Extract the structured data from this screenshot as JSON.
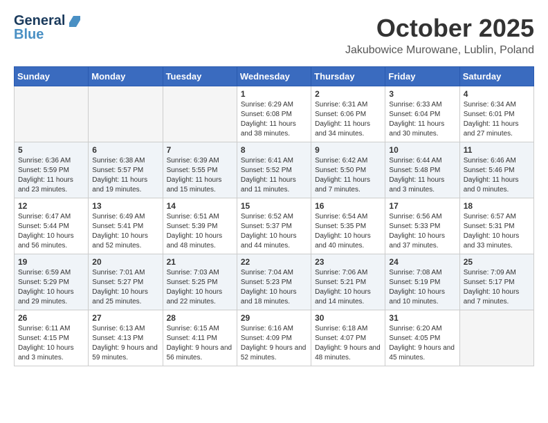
{
  "header": {
    "logo_line1": "General",
    "logo_line2": "Blue",
    "title": "October 2025",
    "subtitle": "Jakubowice Murowane, Lublin, Poland"
  },
  "weekdays": [
    "Sunday",
    "Monday",
    "Tuesday",
    "Wednesday",
    "Thursday",
    "Friday",
    "Saturday"
  ],
  "weeks": [
    [
      {
        "day": "",
        "sunrise": "",
        "sunset": "",
        "daylight": ""
      },
      {
        "day": "",
        "sunrise": "",
        "sunset": "",
        "daylight": ""
      },
      {
        "day": "",
        "sunrise": "",
        "sunset": "",
        "daylight": ""
      },
      {
        "day": "1",
        "sunrise": "Sunrise: 6:29 AM",
        "sunset": "Sunset: 6:08 PM",
        "daylight": "Daylight: 11 hours and 38 minutes."
      },
      {
        "day": "2",
        "sunrise": "Sunrise: 6:31 AM",
        "sunset": "Sunset: 6:06 PM",
        "daylight": "Daylight: 11 hours and 34 minutes."
      },
      {
        "day": "3",
        "sunrise": "Sunrise: 6:33 AM",
        "sunset": "Sunset: 6:04 PM",
        "daylight": "Daylight: 11 hours and 30 minutes."
      },
      {
        "day": "4",
        "sunrise": "Sunrise: 6:34 AM",
        "sunset": "Sunset: 6:01 PM",
        "daylight": "Daylight: 11 hours and 27 minutes."
      }
    ],
    [
      {
        "day": "5",
        "sunrise": "Sunrise: 6:36 AM",
        "sunset": "Sunset: 5:59 PM",
        "daylight": "Daylight: 11 hours and 23 minutes."
      },
      {
        "day": "6",
        "sunrise": "Sunrise: 6:38 AM",
        "sunset": "Sunset: 5:57 PM",
        "daylight": "Daylight: 11 hours and 19 minutes."
      },
      {
        "day": "7",
        "sunrise": "Sunrise: 6:39 AM",
        "sunset": "Sunset: 5:55 PM",
        "daylight": "Daylight: 11 hours and 15 minutes."
      },
      {
        "day": "8",
        "sunrise": "Sunrise: 6:41 AM",
        "sunset": "Sunset: 5:52 PM",
        "daylight": "Daylight: 11 hours and 11 minutes."
      },
      {
        "day": "9",
        "sunrise": "Sunrise: 6:42 AM",
        "sunset": "Sunset: 5:50 PM",
        "daylight": "Daylight: 11 hours and 7 minutes."
      },
      {
        "day": "10",
        "sunrise": "Sunrise: 6:44 AM",
        "sunset": "Sunset: 5:48 PM",
        "daylight": "Daylight: 11 hours and 3 minutes."
      },
      {
        "day": "11",
        "sunrise": "Sunrise: 6:46 AM",
        "sunset": "Sunset: 5:46 PM",
        "daylight": "Daylight: 11 hours and 0 minutes."
      }
    ],
    [
      {
        "day": "12",
        "sunrise": "Sunrise: 6:47 AM",
        "sunset": "Sunset: 5:44 PM",
        "daylight": "Daylight: 10 hours and 56 minutes."
      },
      {
        "day": "13",
        "sunrise": "Sunrise: 6:49 AM",
        "sunset": "Sunset: 5:41 PM",
        "daylight": "Daylight: 10 hours and 52 minutes."
      },
      {
        "day": "14",
        "sunrise": "Sunrise: 6:51 AM",
        "sunset": "Sunset: 5:39 PM",
        "daylight": "Daylight: 10 hours and 48 minutes."
      },
      {
        "day": "15",
        "sunrise": "Sunrise: 6:52 AM",
        "sunset": "Sunset: 5:37 PM",
        "daylight": "Daylight: 10 hours and 44 minutes."
      },
      {
        "day": "16",
        "sunrise": "Sunrise: 6:54 AM",
        "sunset": "Sunset: 5:35 PM",
        "daylight": "Daylight: 10 hours and 40 minutes."
      },
      {
        "day": "17",
        "sunrise": "Sunrise: 6:56 AM",
        "sunset": "Sunset: 5:33 PM",
        "daylight": "Daylight: 10 hours and 37 minutes."
      },
      {
        "day": "18",
        "sunrise": "Sunrise: 6:57 AM",
        "sunset": "Sunset: 5:31 PM",
        "daylight": "Daylight: 10 hours and 33 minutes."
      }
    ],
    [
      {
        "day": "19",
        "sunrise": "Sunrise: 6:59 AM",
        "sunset": "Sunset: 5:29 PM",
        "daylight": "Daylight: 10 hours and 29 minutes."
      },
      {
        "day": "20",
        "sunrise": "Sunrise: 7:01 AM",
        "sunset": "Sunset: 5:27 PM",
        "daylight": "Daylight: 10 hours and 25 minutes."
      },
      {
        "day": "21",
        "sunrise": "Sunrise: 7:03 AM",
        "sunset": "Sunset: 5:25 PM",
        "daylight": "Daylight: 10 hours and 22 minutes."
      },
      {
        "day": "22",
        "sunrise": "Sunrise: 7:04 AM",
        "sunset": "Sunset: 5:23 PM",
        "daylight": "Daylight: 10 hours and 18 minutes."
      },
      {
        "day": "23",
        "sunrise": "Sunrise: 7:06 AM",
        "sunset": "Sunset: 5:21 PM",
        "daylight": "Daylight: 10 hours and 14 minutes."
      },
      {
        "day": "24",
        "sunrise": "Sunrise: 7:08 AM",
        "sunset": "Sunset: 5:19 PM",
        "daylight": "Daylight: 10 hours and 10 minutes."
      },
      {
        "day": "25",
        "sunrise": "Sunrise: 7:09 AM",
        "sunset": "Sunset: 5:17 PM",
        "daylight": "Daylight: 10 hours and 7 minutes."
      }
    ],
    [
      {
        "day": "26",
        "sunrise": "Sunrise: 6:11 AM",
        "sunset": "Sunset: 4:15 PM",
        "daylight": "Daylight: 10 hours and 3 minutes."
      },
      {
        "day": "27",
        "sunrise": "Sunrise: 6:13 AM",
        "sunset": "Sunset: 4:13 PM",
        "daylight": "Daylight: 9 hours and 59 minutes."
      },
      {
        "day": "28",
        "sunrise": "Sunrise: 6:15 AM",
        "sunset": "Sunset: 4:11 PM",
        "daylight": "Daylight: 9 hours and 56 minutes."
      },
      {
        "day": "29",
        "sunrise": "Sunrise: 6:16 AM",
        "sunset": "Sunset: 4:09 PM",
        "daylight": "Daylight: 9 hours and 52 minutes."
      },
      {
        "day": "30",
        "sunrise": "Sunrise: 6:18 AM",
        "sunset": "Sunset: 4:07 PM",
        "daylight": "Daylight: 9 hours and 48 minutes."
      },
      {
        "day": "31",
        "sunrise": "Sunrise: 6:20 AM",
        "sunset": "Sunset: 4:05 PM",
        "daylight": "Daylight: 9 hours and 45 minutes."
      },
      {
        "day": "",
        "sunrise": "",
        "sunset": "",
        "daylight": ""
      }
    ]
  ]
}
